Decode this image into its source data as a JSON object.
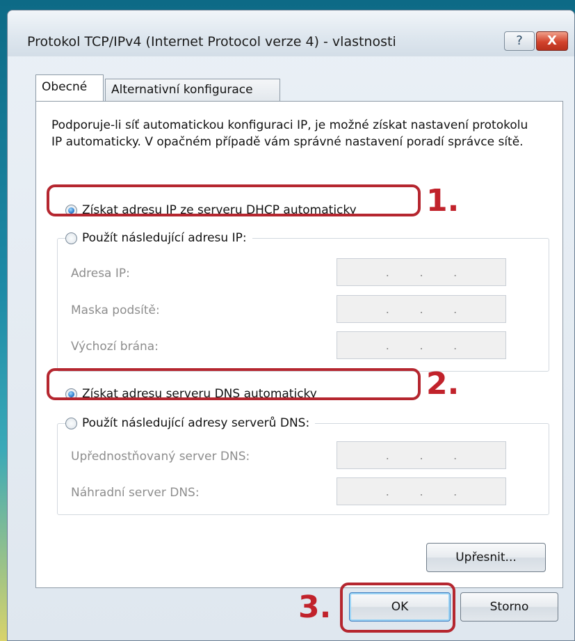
{
  "window": {
    "title": "Protokol TCP/IPv4 (Internet Protocol verze 4) - vlastnosti",
    "help_label": "?",
    "close_label": "X"
  },
  "tabs": [
    {
      "label": "Obecné",
      "active": true
    },
    {
      "label": "Alternativní konfigurace",
      "active": false
    }
  ],
  "intro_text": "Podporuje-li síť automatickou konfiguraci IP, je možné získat nastavení protokolu IP automaticky. V opačném případě vám správné nastavení poradí správce sítě.",
  "ip_section": {
    "auto_label": "Získat adresu IP ze serveru DHCP automaticky",
    "auto_checked": true,
    "manual_label": "Použít následující adresu IP:",
    "manual_checked": false,
    "fields": [
      {
        "label": "Adresa IP:",
        "value": ". . ."
      },
      {
        "label": "Maska podsítě:",
        "value": ". . ."
      },
      {
        "label": "Výchozí brána:",
        "value": ". . ."
      }
    ]
  },
  "dns_section": {
    "auto_label": "Získat adresu serveru DNS automaticky",
    "auto_checked": true,
    "manual_label": "Použít následující adresy serverů DNS:",
    "manual_checked": false,
    "fields": [
      {
        "label": "Upřednostňovaný server DNS:",
        "value": ". . ."
      },
      {
        "label": "Náhradní server DNS:",
        "value": ". . ."
      }
    ]
  },
  "advanced_button": "Upřesnit...",
  "ok_button": "OK",
  "cancel_button": "Storno",
  "steps": [
    "1.",
    "2.",
    "3."
  ],
  "colors": {
    "highlight": "#b5262f",
    "step_number": "#c1222b"
  }
}
